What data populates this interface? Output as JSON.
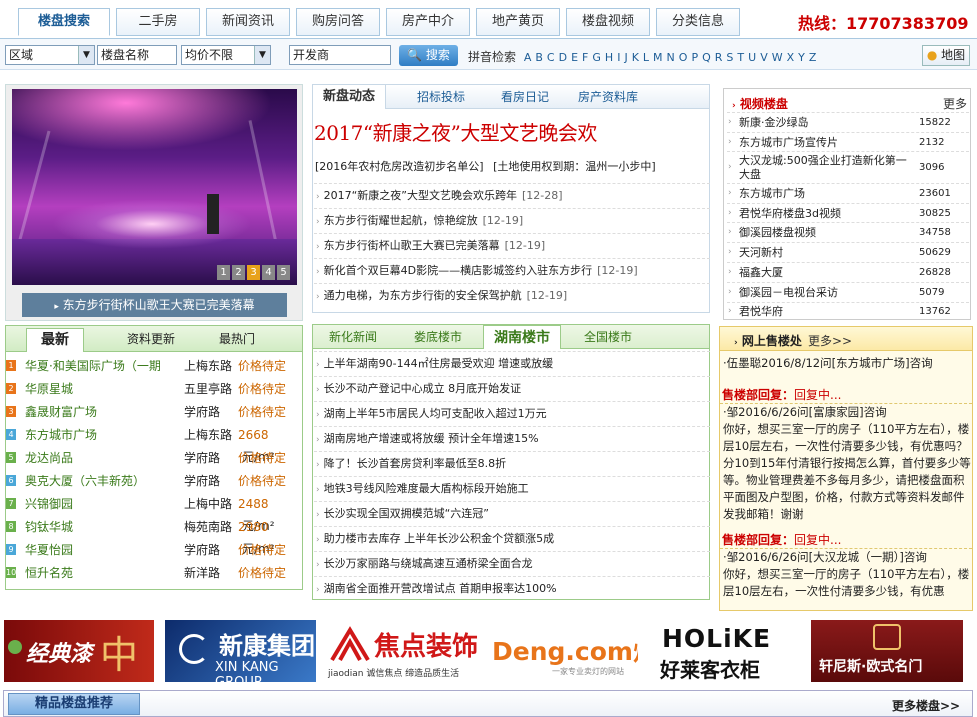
{
  "nav": {
    "tabs": [
      "楼盘搜索",
      "二手房",
      "新闻资讯",
      "购房问答",
      "房产中介",
      "地产黄页",
      "楼盘视频",
      "分类信息"
    ],
    "hotline": "热线：17707383709"
  },
  "search": {
    "region": "区域",
    "name_placeholder": "楼盘名称",
    "price": "均价不限",
    "developer_placeholder": "开发商",
    "button": "搜索",
    "pinyin_label": "拼音检索",
    "letters": [
      "A",
      "B",
      "C",
      "D",
      "E",
      "F",
      "G",
      "H",
      "I",
      "J",
      "K",
      "L",
      "M",
      "N",
      "O",
      "P",
      "Q",
      "R",
      "S",
      "T",
      "U",
      "V",
      "W",
      "X",
      "Y",
      "Z"
    ],
    "map_button": "地图"
  },
  "slideshow": {
    "caption": "东方步行街杯山歌王大赛已完美落幕",
    "pages": [
      "1",
      "2",
      "3",
      "4",
      "5"
    ]
  },
  "news": {
    "tabs": [
      "新盘动态",
      "招标投标",
      "看房日记",
      "房产资料库"
    ],
    "headline": "2017“新康之夜”大型文艺晚会欢",
    "sublink1": "[2016年农村危房改造初步名单公]",
    "sublink2": "[土地使用权到期：温州一小步中]",
    "items": [
      {
        "title": "2017“新康之夜”大型文艺晚会欢乐跨年",
        "date": "[12-28]"
      },
      {
        "title": "东方步行街耀世起航，惊艳绽放",
        "date": "[12-19]"
      },
      {
        "title": "东方步行街杯山歌王大赛已完美落幕",
        "date": "[12-19]"
      },
      {
        "title": "新化首个双巨幕4D影院——横店影城签约入驻东方步行",
        "date": "[12-19]"
      },
      {
        "title": "通力电梯，为东方步行街的安全保驾护航",
        "date": "[12-19]"
      }
    ]
  },
  "video": {
    "title": "视频楼盘",
    "more": "更多",
    "items": [
      {
        "name": "新康·金沙绿岛",
        "count": "15822"
      },
      {
        "name": "东方城市广场宣传片",
        "count": "2132"
      },
      {
        "name": "大汉龙城:500强企业打造新化第一大盘",
        "count": "3096"
      },
      {
        "name": "东方城市广场",
        "count": "23601"
      },
      {
        "name": "君悦华府楼盘3d视频",
        "count": "30825"
      },
      {
        "name": "御溪园楼盘视频",
        "count": "34758"
      },
      {
        "name": "天河新村",
        "count": "50629"
      },
      {
        "name": "福鑫大厦",
        "count": "26828"
      },
      {
        "name": "御溪园－电视台采访",
        "count": "5079"
      },
      {
        "name": "君悦华府",
        "count": "13762"
      }
    ]
  },
  "latest": {
    "tabs": [
      "最新",
      "资料更新",
      "最热门"
    ],
    "items": [
      {
        "num": "1",
        "name": "华夏·和美国际广场（一期",
        "road": "上梅东路",
        "price": "价格待定",
        "unit": ""
      },
      {
        "num": "2",
        "name": "华原星城",
        "road": "五里亭路",
        "price": "价格待定",
        "unit": ""
      },
      {
        "num": "3",
        "name": "鑫晟财富广场",
        "road": "学府路",
        "price": "价格待定",
        "unit": ""
      },
      {
        "num": "4",
        "name": "东方城市广场",
        "road": "上梅东路",
        "price": "2668",
        "unit": "元/m²"
      },
      {
        "num": "5",
        "name": "龙达尚品",
        "road": "学府路",
        "price": "价格待定",
        "unit": ""
      },
      {
        "num": "6",
        "name": "奥克大厦（六丰新苑）",
        "road": "学府路",
        "price": "价格待定",
        "unit": ""
      },
      {
        "num": "7",
        "name": "兴锦御园",
        "road": "上梅中路",
        "price": "2488",
        "unit": "元/m²"
      },
      {
        "num": "8",
        "name": "钧钛华城",
        "road": "梅苑南路",
        "price": "2980",
        "unit": "元/m²"
      },
      {
        "num": "9",
        "name": "华夏怡园",
        "road": "学府路",
        "price": "价格待定",
        "unit": ""
      },
      {
        "num": "10",
        "name": "恒升名苑",
        "road": "新洋路",
        "price": "价格待定",
        "unit": ""
      }
    ]
  },
  "hunan": {
    "tabs": [
      "新化新闻",
      "娄底楼市",
      "湖南楼市",
      "全国楼市"
    ],
    "items": [
      "上半年湖南90-144㎡住房最受欢迎 增速或放缓",
      "长沙不动产登记中心成立 8月底开始发证",
      "湖南上半年5市居民人均可支配收入超过1万元",
      "湖南房地产增速或将放缓 预计全年增速15%",
      "降了！长沙首套房贷利率最低至8.8折",
      "地铁3号线风险难度最大盾构标段开始施工",
      "长沙实现全国双拥模范城“六连冠”",
      "助力楼市去库存 上半年长沙公积金个贷额涨5成",
      "长沙万家丽路与绕城高速互通桥梁全面合龙",
      "湖南省全面推开营改增试点 首期申报率达100%"
    ]
  },
  "sales": {
    "title": "网上售楼处",
    "more": "更多>>",
    "q1": "·伍墨聪2016/8/12问[东方城市广场]咨询",
    "reply_label": "售楼部回复：",
    "reply_text": "回复中...",
    "q2_head": "·邹2016/6/26问[富康家园]咨询",
    "q2_body": "你好，想买三室一厅的房子（110平方左右），楼层10层左右，一次性付清要多少钱，有优惠吗？分10到15年付清银行按揭怎么算，首付要多少等等。物业管理费差不多每月多少，请把楼盘面积平面图及户型图，价格，付款方式等资料发邮件发我邮箱！谢谢",
    "q3_head": "·邹2016/6/26问[大汉龙城（一期）]咨询",
    "q3_body": "你好，想买三室一厅的房子（110平方左右），楼层10层左右，一次性付清要多少钱，有优惠"
  },
  "ads": {
    "ad1": "经典漆",
    "ad2_title": "新康集团",
    "ad2_sub": "XIN KANG GROUP",
    "ad3_title": "焦点装饰",
    "ad3_sub": "jiaodian 诚信焦点 缔造品质生活",
    "ad4_title": "Deng.com灯网",
    "ad4_sub": "一家专业卖灯的网站",
    "ad5_title": "HOLiKE",
    "ad5_sub": "好莱客衣柜",
    "ad6_title": "轩尼斯·欧式名门"
  },
  "bottom": {
    "title": "精品楼盘推荐",
    "more": "更多楼盘>>"
  },
  "colors": {
    "accent_blue": "#1d5d96",
    "accent_red": "#cc0000",
    "green": "#3a7a1a"
  }
}
